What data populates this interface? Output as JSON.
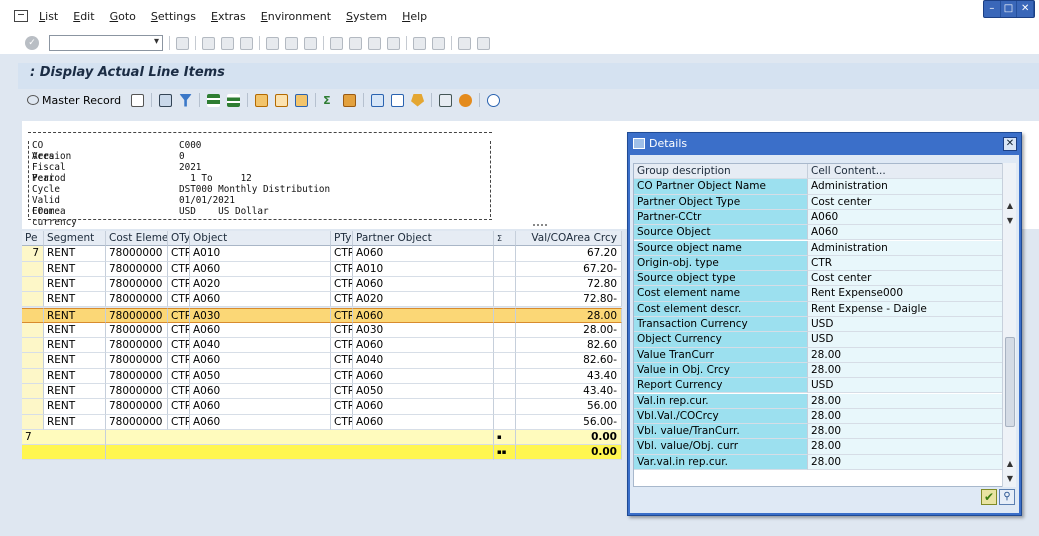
{
  "menu": [
    "List",
    "Edit",
    "Goto",
    "Settings",
    "Extras",
    "Environment",
    "System",
    "Help"
  ],
  "window_controls": {
    "minimize": "–",
    "maximize": "□",
    "close": "✕"
  },
  "title": ": Display Actual Line Items",
  "app_toolbar": {
    "master_record": "Master Record"
  },
  "header": {
    "rows": [
      {
        "label": "CO Area",
        "value": "C000"
      },
      {
        "label": "Version",
        "value": "0"
      },
      {
        "label": "Fiscal Year",
        "value": "2021"
      },
      {
        "label": "Period",
        "value": "  1 To     12"
      },
      {
        "label": "Cycle",
        "value": "DST000 Monthly Distribution"
      },
      {
        "label": "Valid From",
        "value": "01/01/2021"
      },
      {
        "label": "COarea currency",
        "value": "USD    US Dollar"
      }
    ]
  },
  "grid": {
    "columns": [
      "Pe",
      "Segment",
      "Cost Element",
      "OTy",
      "Object",
      "PTy",
      "Partner Object",
      "Σ",
      "Val/COArea Crcy"
    ],
    "rows": [
      {
        "pe": "7",
        "segment": "RENT",
        "cost_element": "78000000",
        "oty": "CTR",
        "object": "A010",
        "pty": "CTR",
        "partner": "A060",
        "value": "67.20"
      },
      {
        "pe": "",
        "segment": "RENT",
        "cost_element": "78000000",
        "oty": "CTR",
        "object": "A060",
        "pty": "CTR",
        "partner": "A010",
        "value": "67.20-"
      },
      {
        "pe": "",
        "segment": "RENT",
        "cost_element": "78000000",
        "oty": "CTR",
        "object": "A020",
        "pty": "CTR",
        "partner": "A060",
        "value": "72.80"
      },
      {
        "pe": "",
        "segment": "RENT",
        "cost_element": "78000000",
        "oty": "CTR",
        "object": "A060",
        "pty": "CTR",
        "partner": "A020",
        "value": "72.80-"
      },
      {
        "pe": "",
        "segment": "RENT",
        "cost_element": "78000000",
        "oty": "CTR",
        "object": "A030",
        "pty": "CTR",
        "partner": "A060",
        "value": "28.00"
      },
      {
        "pe": "",
        "segment": "RENT",
        "cost_element": "78000000",
        "oty": "CTR",
        "object": "A060",
        "pty": "CTR",
        "partner": "A030",
        "value": "28.00-"
      },
      {
        "pe": "",
        "segment": "RENT",
        "cost_element": "78000000",
        "oty": "CTR",
        "object": "A040",
        "pty": "CTR",
        "partner": "A060",
        "value": "82.60"
      },
      {
        "pe": "",
        "segment": "RENT",
        "cost_element": "78000000",
        "oty": "CTR",
        "object": "A060",
        "pty": "CTR",
        "partner": "A040",
        "value": "82.60-"
      },
      {
        "pe": "",
        "segment": "RENT",
        "cost_element": "78000000",
        "oty": "CTR",
        "object": "A050",
        "pty": "CTR",
        "partner": "A060",
        "value": "43.40"
      },
      {
        "pe": "",
        "segment": "RENT",
        "cost_element": "78000000",
        "oty": "CTR",
        "object": "A060",
        "pty": "CTR",
        "partner": "A050",
        "value": "43.40-"
      },
      {
        "pe": "",
        "segment": "RENT",
        "cost_element": "78000000",
        "oty": "CTR",
        "object": "A060",
        "pty": "CTR",
        "partner": "A060",
        "value": "56.00"
      },
      {
        "pe": "",
        "segment": "RENT",
        "cost_element": "78000000",
        "oty": "CTR",
        "object": "A060",
        "pty": "CTR",
        "partner": "A060",
        "value": "56.00-"
      }
    ],
    "subtotal": {
      "pe": "7",
      "mark": "▪",
      "value": "0.00"
    },
    "total": {
      "mark": "▪▪",
      "value": "0.00"
    }
  },
  "dialog": {
    "title": "Details",
    "columns": [
      "Group description",
      "Cell Content..."
    ],
    "rows": [
      [
        "CO Partner Object Name",
        "Administration"
      ],
      [
        "Partner Object Type",
        "Cost center"
      ],
      [
        "Partner-CCtr",
        "A060"
      ],
      [
        "Source Object",
        "A060"
      ],
      [
        "Source object name",
        "Administration"
      ],
      [
        "Origin-obj. type",
        "CTR"
      ],
      [
        "Source object type",
        "Cost center"
      ],
      [
        "Cost element name",
        "Rent Expense000"
      ],
      [
        "Cost element descr.",
        "Rent Expense - Daigle"
      ],
      [
        "Transaction Currency",
        "USD"
      ],
      [
        "Object Currency",
        "USD"
      ],
      [
        "Value TranCurr",
        "28.00"
      ],
      [
        "Value in Obj. Crcy",
        "28.00"
      ],
      [
        "Report Currency",
        "USD"
      ],
      [
        "Val.in rep.cur.",
        "28.00"
      ],
      [
        "Vbl.Val./COCrcy",
        "28.00"
      ],
      [
        "Vbl. value/TranCurr.",
        "28.00"
      ],
      [
        "Vbl. value/Obj. curr",
        "28.00"
      ],
      [
        "Var.val.in rep.cur.",
        "28.00"
      ]
    ],
    "ok_icon": "✔",
    "find_icon": "find-icon"
  }
}
